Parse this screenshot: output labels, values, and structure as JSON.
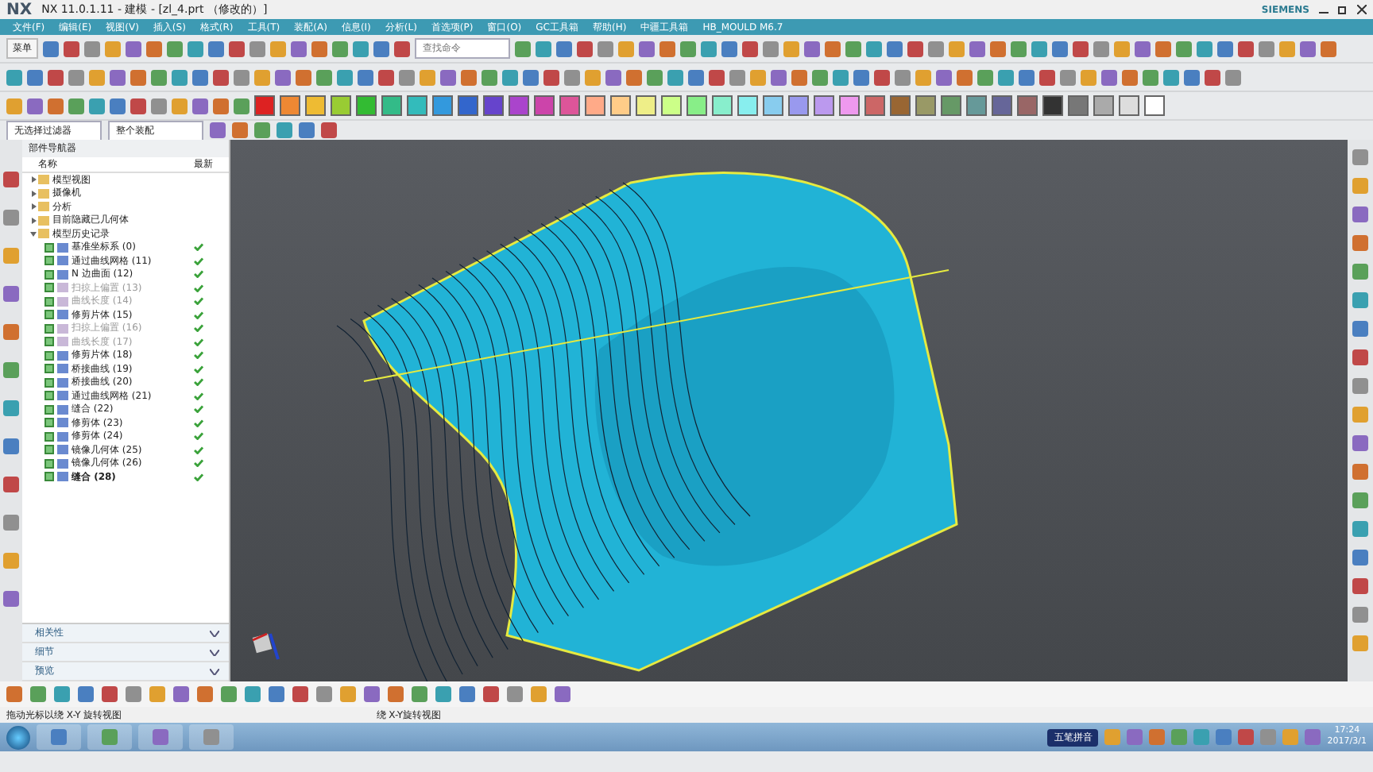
{
  "window": {
    "logo": "NX",
    "title": "NX 11.0.1.11 - 建模 - [zl_4.prt （修改的）]",
    "brand": "SIEMENS"
  },
  "menu": [
    {
      "label": "文件(F)"
    },
    {
      "label": "编辑(E)"
    },
    {
      "label": "视图(V)"
    },
    {
      "label": "插入(S)"
    },
    {
      "label": "格式(R)"
    },
    {
      "label": "工具(T)"
    },
    {
      "label": "装配(A)"
    },
    {
      "label": "信息(I)"
    },
    {
      "label": "分析(L)"
    },
    {
      "label": "首选项(P)"
    },
    {
      "label": "窗口(O)"
    },
    {
      "label": "GC工具箱"
    },
    {
      "label": "帮助(H)"
    },
    {
      "label": "中疆工具箱"
    },
    {
      "label": "HB_MOULD M6.7"
    }
  ],
  "toolbar": {
    "menu_button": "菜单",
    "command_search": {
      "placeholder": "查找命令"
    }
  },
  "selection_bar": {
    "filter": "无选择过滤器",
    "scope": "整个装配"
  },
  "navigator": {
    "title": "部件导航器",
    "columns": [
      "名称",
      "最新"
    ],
    "items": [
      {
        "label": "模型视图",
        "expanded": false
      },
      {
        "label": "摄像机",
        "expanded": false
      },
      {
        "label": "分析",
        "expanded": false
      },
      {
        "label": "目前隐藏已几何体",
        "expanded": false
      },
      {
        "label": "模型历史记录",
        "expanded": true,
        "children": [
          {
            "label": "基准坐标系 (0)",
            "checked": true,
            "disabled": false,
            "current": false
          },
          {
            "label": "通过曲线网格 (11)",
            "checked": true,
            "disabled": false,
            "current": false
          },
          {
            "label": "N 边曲面 (12)",
            "checked": true,
            "disabled": false,
            "current": false
          },
          {
            "label": "扫掠上偏置 (13)",
            "checked": true,
            "disabled": true,
            "current": false
          },
          {
            "label": "曲线长度 (14)",
            "checked": true,
            "disabled": true,
            "current": false
          },
          {
            "label": "修剪片体 (15)",
            "checked": true,
            "disabled": false,
            "current": false
          },
          {
            "label": "扫掠上偏置 (16)",
            "checked": true,
            "disabled": true,
            "current": false
          },
          {
            "label": "曲线长度 (17)",
            "checked": true,
            "disabled": true,
            "current": false
          },
          {
            "label": "修剪片体 (18)",
            "checked": true,
            "disabled": false,
            "current": false
          },
          {
            "label": "桥接曲线 (19)",
            "checked": true,
            "disabled": false,
            "current": false
          },
          {
            "label": "桥接曲线 (20)",
            "checked": true,
            "disabled": false,
            "current": false
          },
          {
            "label": "通过曲线网格 (21)",
            "checked": true,
            "disabled": false,
            "current": false
          },
          {
            "label": "缝合 (22)",
            "checked": true,
            "disabled": false,
            "current": false
          },
          {
            "label": "修剪体 (23)",
            "checked": true,
            "disabled": false,
            "current": false
          },
          {
            "label": "修剪体 (24)",
            "checked": true,
            "disabled": false,
            "current": false
          },
          {
            "label": "镜像几何体 (25)",
            "checked": true,
            "disabled": false,
            "current": false
          },
          {
            "label": "镜像几何体 (26)",
            "checked": true,
            "disabled": false,
            "current": false
          },
          {
            "label": "缝合 (28)",
            "checked": true,
            "disabled": false,
            "current": true
          }
        ]
      }
    ]
  },
  "panels": [
    {
      "label": "相关性",
      "expanded": false
    },
    {
      "label": "细节",
      "expanded": false
    },
    {
      "label": "预览",
      "expanded": false
    }
  ],
  "status_bar": {
    "prompt": "拖动光标以绕 X-Y 旋转视图",
    "view_status": "绕 X-Y旋转视图"
  },
  "taskbar": {
    "ime": "五笔拼音",
    "time": "17:24",
    "date": "2017/3/1"
  }
}
